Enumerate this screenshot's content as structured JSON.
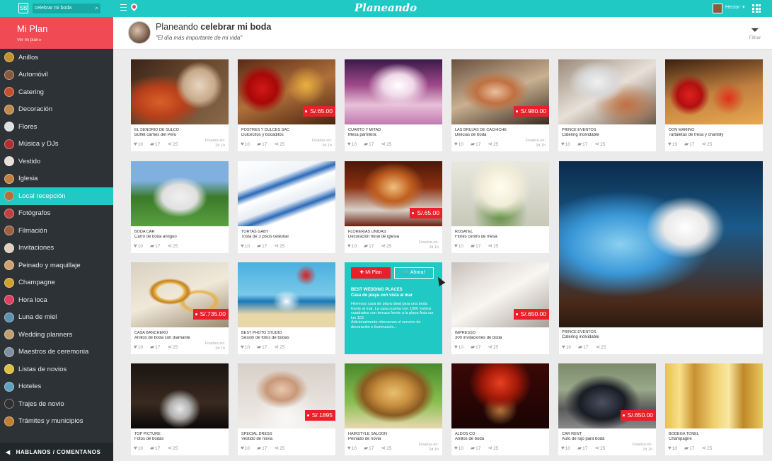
{
  "topbar": {
    "logo_text": "SB",
    "search_value": "celebrar mi boda",
    "brand": "Planeando",
    "user_name": "Hector"
  },
  "sidebar": {
    "plan_title": "Mi Plan",
    "plan_link": "Ver mi plan",
    "items": [
      {
        "label": "Anillos",
        "color": "#c8902a"
      },
      {
        "label": "Automóvil",
        "color": "#8a5a3a"
      },
      {
        "label": "Catering",
        "color": "#c0502a"
      },
      {
        "label": "Decoración",
        "color": "#c08a4a"
      },
      {
        "label": "Flores",
        "color": "#e0e0e0"
      },
      {
        "label": "Música y DJs",
        "color": "#b03030"
      },
      {
        "label": "Vestido",
        "color": "#e8e0d8"
      },
      {
        "label": "Iglesia",
        "color": "#c08040"
      },
      {
        "label": "Local recepción",
        "color": "#b07040"
      },
      {
        "label": "Fotógrafos",
        "color": "#c04040"
      },
      {
        "label": "Filmación",
        "color": "#a06040"
      },
      {
        "label": "Invitaciones",
        "color": "#e0d0c0"
      },
      {
        "label": "Peinado y maquillaje",
        "color": "#d0a070"
      },
      {
        "label": "Champagne",
        "color": "#d0a030"
      },
      {
        "label": "Hora loca",
        "color": "#e04060"
      },
      {
        "label": "Luna de miel",
        "color": "#6090b0"
      },
      {
        "label": "Wedding planners",
        "color": "#c0a070"
      },
      {
        "label": "Maestros de ceremonia",
        "color": "#8090a0"
      },
      {
        "label": "Listas de novios",
        "color": "#e0c040"
      },
      {
        "label": "Hoteles",
        "color": "#60a0c0"
      },
      {
        "label": "Trajes de novio",
        "color": "#303030"
      },
      {
        "label": "Trámites y municipios",
        "color": "#c08030"
      }
    ],
    "active_index": 8,
    "footer": "HABLANOS / COMENTANOS"
  },
  "header": {
    "title_prefix": "Planeando",
    "title_bold": "celebrar mi boda",
    "subtitle": "\"El día más importante de mi vida\"",
    "filter_label": "Filtrar"
  },
  "cards": [
    {
      "name": "EL SEÑORIO DE SULCO",
      "desc": "Buffet carnes del Perú",
      "likes": "10",
      "comments": "17",
      "shares": "25",
      "fin": true,
      "price": null,
      "bg": "radial-gradient(circle at 70% 40%,#e8d5c0 0,#c7a98a 20%,transparent 30%),radial-gradient(ellipse at 30% 65%,#d9602a 0,#b8401a 25%,transparent 45%),linear-gradient(135deg,#3a2418,#6b4a30 50%,#8a6a4a)"
    },
    {
      "name": "POSTRES Y DULCES SAC",
      "desc": "Dulcecitos y bocaditos",
      "likes": "10",
      "comments": "17",
      "shares": "25",
      "fin": true,
      "price": "S/.65.00",
      "bg": "radial-gradient(circle at 25% 45%,#d01818 0,#a80808 18%,transparent 30%),radial-gradient(circle at 70% 40%,#e8b040 0,transparent 25%),linear-gradient(160deg,#5a2a18,#b0703a 50%,#4a2410)"
    },
    {
      "name": "CUARTO Y MITAD",
      "desc": "Mesa parrillera",
      "likes": "10",
      "comments": "17",
      "shares": "25",
      "fin": false,
      "price": null,
      "bg": "radial-gradient(ellipse at 55% 40%,#fff 0,#f0d8e8 20%,transparent 40%),linear-gradient(180deg,#3a1a4a,#a04a8a 40%,#e8c0d8 70%,#c07ab0)"
    },
    {
      "name": "LAS BRUJAS DE CACHICHE",
      "desc": "Delicias de boda",
      "likes": "10",
      "comments": "17",
      "shares": "25",
      "fin": true,
      "price": "S/.980.00",
      "bg": "radial-gradient(ellipse at 45% 50%,#e8c0a0 0,#c07040 25%,transparent 45%),linear-gradient(160deg,#6a5040,#c8b090 50%,#3a2a20)"
    },
    {
      "name": "PRINCE EVENTOS",
      "desc": "Catering inolvidable",
      "likes": "10",
      "comments": "17",
      "shares": "25",
      "fin": false,
      "price": null,
      "bg": "radial-gradient(ellipse at 40% 35%,#f0f0f0 0,#d8d8d8 20%,transparent 35%),radial-gradient(ellipse at 70% 70%,#c07040 0,transparent 35%),linear-gradient(150deg,#9a8a7a,#e8e0d8 50%,#6a5a4a)"
    },
    {
      "name": "DON MAMINO",
      "desc": "Tartaletas de fresa y chantilly",
      "likes": "19",
      "comments": "17",
      "shares": "25",
      "fin": false,
      "price": null,
      "bg": "radial-gradient(circle at 25% 55%,#e02020 0,#b01010 15%,transparent 25%),radial-gradient(circle at 65% 60%,#e03018 0,transparent 22%),linear-gradient(170deg,#3a2010,#c08040 50%,#e8a850)"
    },
    {
      "name": "BODA CAR",
      "desc": "Carro de boda antiguo",
      "likes": "10",
      "comments": "17",
      "shares": "25",
      "fin": false,
      "price": null,
      "bg": "radial-gradient(ellipse at 50% 55%,#f0f0f0 0,#e0e0e0 25%,transparent 40%),linear-gradient(180deg,#80b0e0 0,#80b0e0 30%,#3a7a2a 55%,#5aa040)"
    },
    {
      "name": "TORTAS GABY",
      "desc": "Tosta de 3 pisos celestial",
      "likes": "10",
      "comments": "17",
      "shares": "25",
      "fin": false,
      "price": null,
      "bg": "linear-gradient(160deg,#fff 0,#f0f4f8 30%,#2a6ab8 38%,#fff 45%,#e8eef4 60%,#2a6ab8 68%,#fff 75%)"
    },
    {
      "name": "FLORERIAS UNIDAS",
      "desc": "Decoración floral de iglesia",
      "likes": "10",
      "comments": "17",
      "shares": "25",
      "fin": true,
      "price": "S/.65.00",
      "bg": "radial-gradient(ellipse at 50% 40%,#f0c080 0,#c06020 25%,transparent 45%),linear-gradient(180deg,#4a1808,#8a3010 40%,#d8d0c8 75%,#6a2010)"
    },
    {
      "name": "ROSATEL",
      "desc": "Flores centro de mesa",
      "likes": "10",
      "comments": "17",
      "shares": "25",
      "fin": false,
      "price": null,
      "bg": "radial-gradient(circle at 50% 40%,#fffef0 0,#f0ecd8 30%,transparent 50%),radial-gradient(ellipse at 50% 80%,#5a8a3a 0,transparent 40%),linear-gradient(180deg,#e8e8e0,#c8c8b8)"
    },
    {
      "name": "CASA BANCHERO",
      "desc": "Anillos de boda con diamante",
      "likes": "10",
      "comments": "17",
      "shares": "25",
      "fin": true,
      "price": "S/.735.00",
      "bg": "radial-gradient(ellipse at 40% 45%,transparent 15%,#e8b040 18%,#c08020 22%,transparent 26%),radial-gradient(ellipse at 70% 60%,transparent 14%,#e8b040 17%,transparent 22%),linear-gradient(160deg,#d8d0c0,#f0e8d8 50%,#9a8a70)"
    },
    {
      "name": "BEST PHOTO STUDIO",
      "desc": "Sesión de fotos de bodas",
      "likes": "10",
      "comments": "17",
      "shares": "25",
      "fin": false,
      "price": null,
      "bg": "radial-gradient(circle at 70% 20%,#d82020 0,transparent 12%),radial-gradient(ellipse at 50% 60%,#fff 0,transparent 20%),linear-gradient(180deg,#4ab0e0 0,#7ac8e8 50%,#1a78b8 60%,#e8d8a8 80%)"
    },
    {
      "name": "IMPRESSO",
      "desc": "300 invitaciones de boda",
      "likes": "10",
      "comments": "17",
      "shares": "25",
      "fin": false,
      "price": "S/.650.00",
      "bg": "linear-gradient(150deg,#c8c0b8 0,#e8e4e0 30%,#f8f6f2 50%,#d8d4ce 70%,#a8a098)"
    },
    {
      "name": "TOP PICTURE",
      "desc": "Fotos de bodas",
      "likes": "10",
      "comments": "17",
      "shares": "25",
      "fin": false,
      "price": null,
      "bg": "radial-gradient(ellipse at 50% 70%,#e8e8e8 0,#b0b0b0 15%,transparent 30%),linear-gradient(180deg,#1a1410,#3a2a20 60%,#0a0806)"
    },
    {
      "name": "SPECIAL DRESS",
      "desc": "Vestido de novia",
      "likes": "10",
      "comments": "17",
      "shares": "25",
      "fin": false,
      "price": "S/.1895",
      "bg": "radial-gradient(ellipse at 45% 40%,#e8c8b0 0,#c89878 20%,transparent 35%),radial-gradient(ellipse at 50% 85%,#f8f8f8 0,transparent 45%),linear-gradient(180deg,#d8d0c8,#f0ece8)"
    },
    {
      "name": "HAIRSTYLE SALOON",
      "desc": "Peinado de novia",
      "likes": "10",
      "comments": "17",
      "shares": "25",
      "fin": true,
      "price": null,
      "bg": "radial-gradient(ellipse at 50% 45%,#e8c070 0,#c89040 25%,#8a5a20 45%,transparent 60%),linear-gradient(180deg,#4a8a2a,#8ac050 60%,#e8d8b0)"
    },
    {
      "name": "ALDOS CO",
      "desc": "Anillos de boda",
      "likes": "10",
      "comments": "17",
      "shares": "25",
      "fin": false,
      "price": null,
      "bg": "radial-gradient(ellipse at 50% 30%,#e84020 0,#a01808 25%,transparent 45%),radial-gradient(ellipse at 50% 70%,#c08040 0,transparent 25%),linear-gradient(180deg,#3a0806,#1a0403)"
    },
    {
      "name": "CAR RENT",
      "desc": "Auto de lujo para boda",
      "likes": "10",
      "comments": "17",
      "shares": "25",
      "fin": true,
      "price": "S/.650.00",
      "bg": "radial-gradient(ellipse at 45% 60%,#4a5060 0,#1a1c24 30%,transparent 50%),linear-gradient(180deg,#7a8a6a,#9aa88a 40%,#5a5a5a 70%,#8a8a8a)"
    },
    {
      "name": "BODEGA TONEL",
      "desc": "Champagne",
      "likes": "10",
      "comments": "17",
      "shares": "25",
      "fin": false,
      "price": null,
      "bg": "linear-gradient(90deg,#e8c050 0,#f8e088 15%,#c89030 30%,#f0d070 50%,#f8e8a0 65%,#c08828 80%,#e8c860)"
    }
  ],
  "featured": {
    "name": "PRINCE EVENTOS",
    "desc": "Catering inolvidable",
    "likes": "10",
    "comments": "17",
    "shares": "25",
    "bg": "radial-gradient(ellipse at 62% 40%,#ffffff 0,#e8e8e8 12%,transparent 22%),radial-gradient(ellipse at 30% 50%,#8ad0f0 0,#3a98d8 25%,transparent 45%),linear-gradient(180deg,#0a2a4a,#1a5a8a 40%,#4a2a1a 85%,#2a1a10)"
  },
  "hover_card": {
    "btn_plan": "Mi Plan",
    "btn_now": "Ahora!",
    "title": "BEST WEDDING PLACES",
    "subtitle": "Casa de playa con vista al mar",
    "para1": "Hermosa casa de playa ideal para una boda frente al mar. La casa cuenta con 1000 metros cuadrados con terraza frente a la playa Asia sur km 102.",
    "para2": "Adicionalmente ofrecemos el servicio de decoración e iluminación..."
  },
  "labels": {
    "fin_label": "Finaliza en:",
    "fin_value": "2d 1h"
  }
}
